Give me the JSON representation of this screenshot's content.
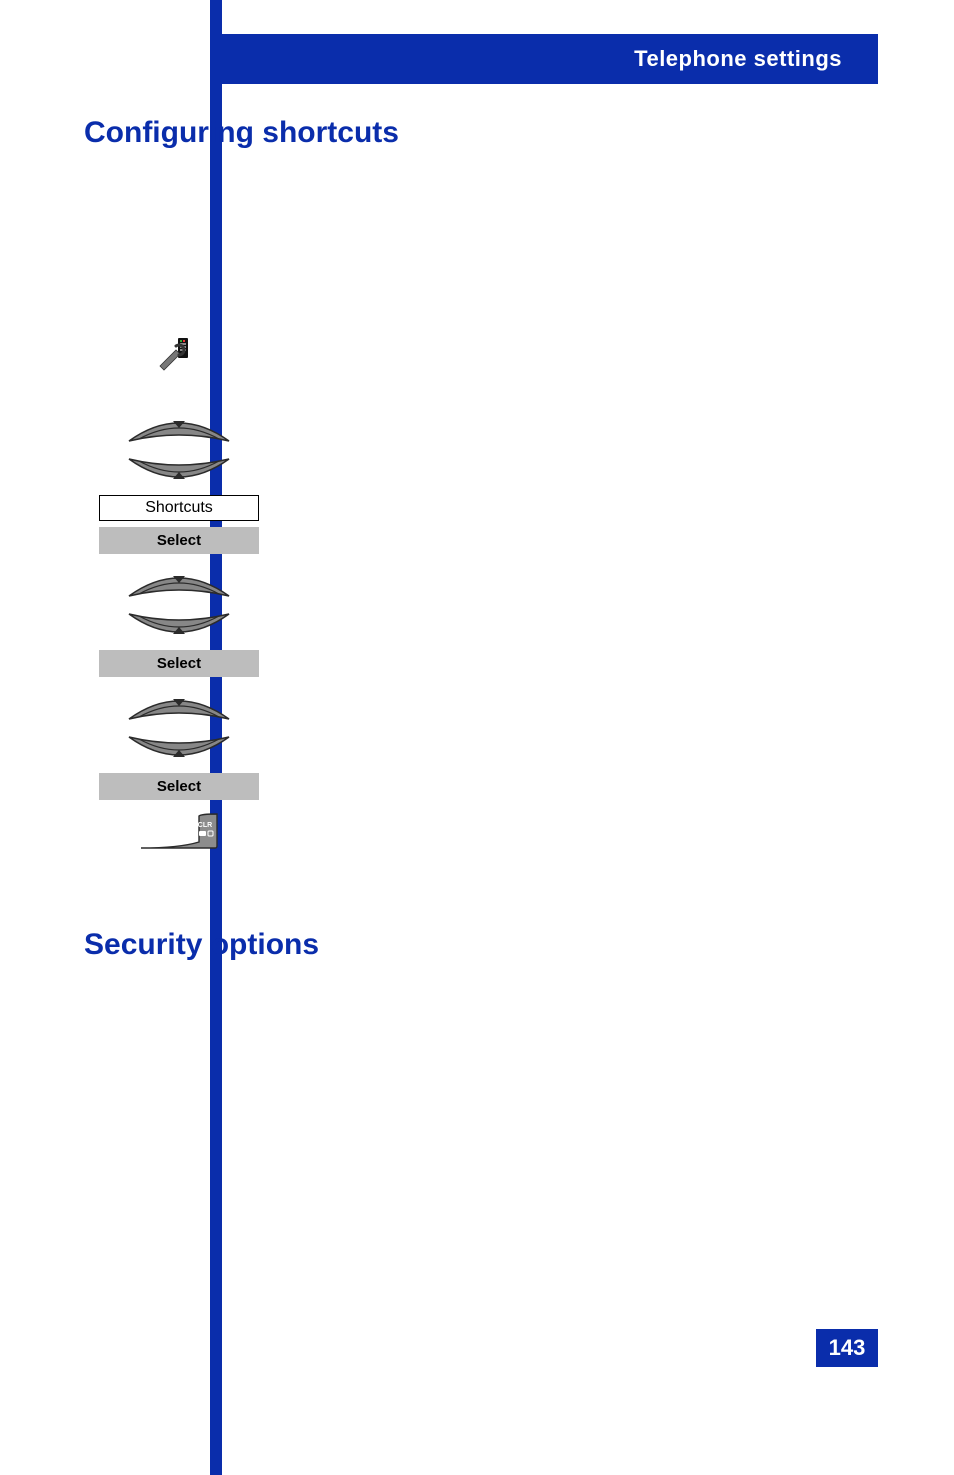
{
  "header": {
    "section": "Telephone settings"
  },
  "headings": {
    "configuring_shortcuts": "Configuring shortcuts",
    "security_options": "Security options"
  },
  "figure": {
    "display_label": "Shortcuts",
    "softkey1": "Select",
    "softkey2": "Select",
    "softkey3": "Select",
    "clr_label": "CLR"
  },
  "page_number": "143"
}
